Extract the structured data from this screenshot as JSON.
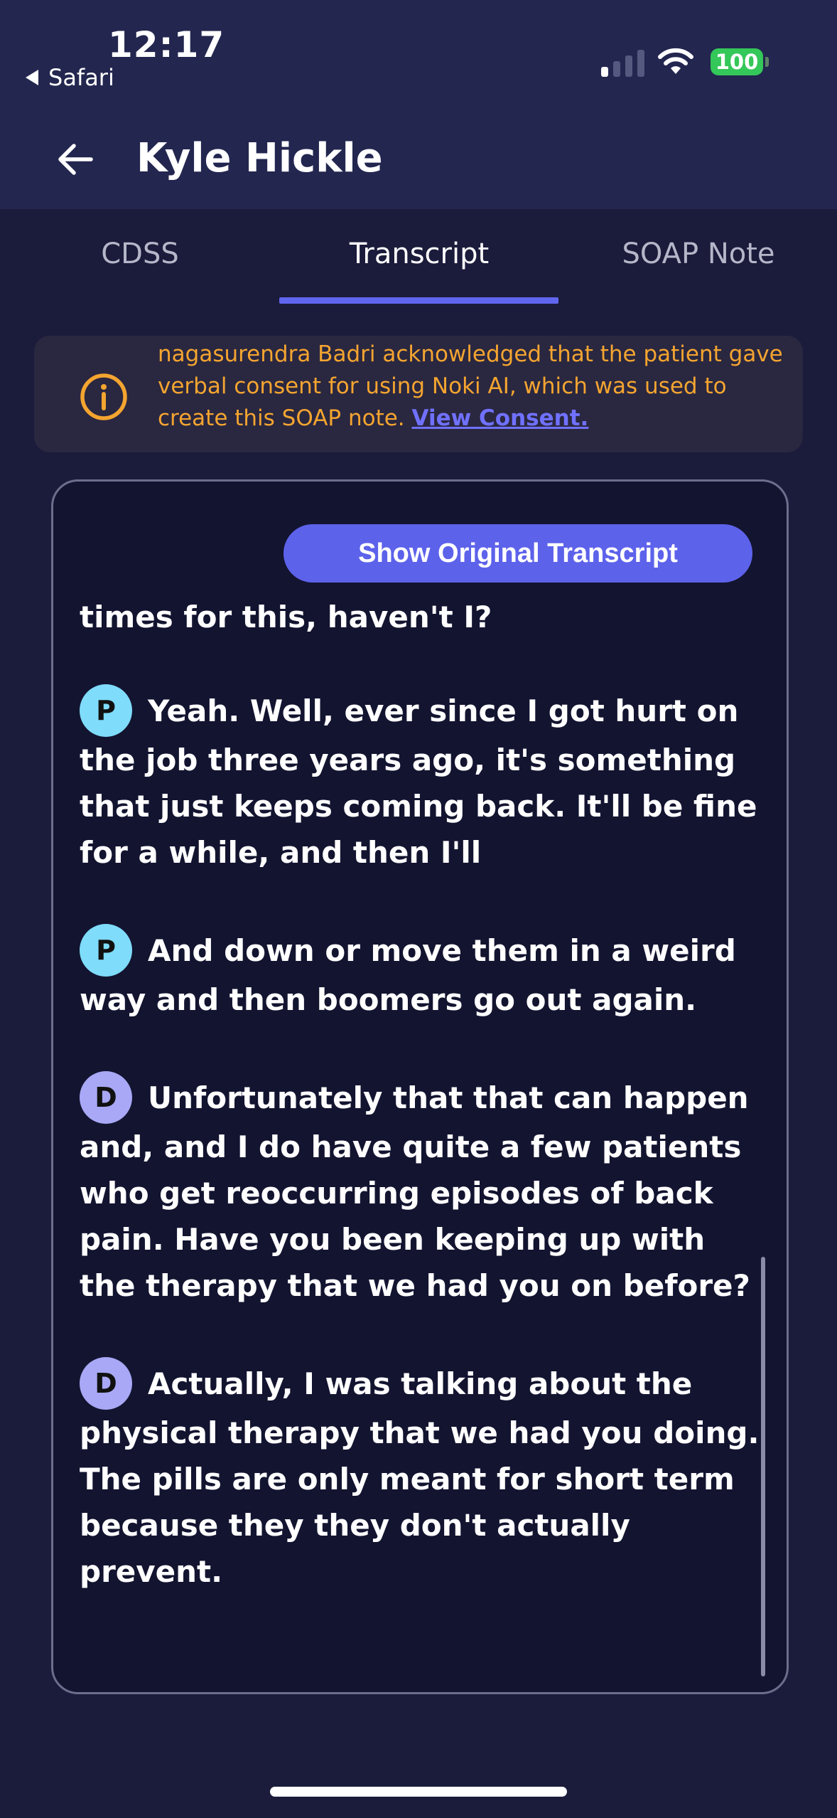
{
  "status_bar": {
    "time": "12:17",
    "back_app": "Safari",
    "battery": "100",
    "colors": {
      "battery": "#34c759"
    }
  },
  "header": {
    "title": "Kyle Hickle"
  },
  "tabs": [
    {
      "label": "CDSS",
      "active": false
    },
    {
      "label": "Transcript",
      "active": true
    },
    {
      "label": "SOAP Note",
      "active": false
    }
  ],
  "consent_banner": {
    "text": "nagasurendra Badri acknowledged that the patient gave verbal consent for using Noki AI, which was used to create this SOAP note.",
    "link": "View Consent.",
    "colors": {
      "text": "#f4a530",
      "link": "#7071ff"
    }
  },
  "transcript": {
    "show_original_label": "Show Original Transcript",
    "partial_text": "times for this, haven't I?",
    "messages": [
      {
        "speaker": "P",
        "text": "Yeah. Well, ever since I got hurt on the job three years ago, it's something that just keeps coming back. It'll be fine for a while, and then I'll"
      },
      {
        "speaker": "P",
        "text": "And down or move them in a weird way and then boomers go out again."
      },
      {
        "speaker": "D",
        "text": "Unfortunately that that can happen and, and I do have quite a few patients who get reoccurring episodes of back pain. Have you been keeping up with the therapy that we had you on before?"
      },
      {
        "speaker": "D",
        "text": "Actually, I was talking about the physical therapy that we had you doing. The pills are only meant for short term because they they don't actually prevent."
      }
    ],
    "speaker_colors": {
      "P": "#7fdcfb",
      "D": "#a8a8f6"
    }
  }
}
